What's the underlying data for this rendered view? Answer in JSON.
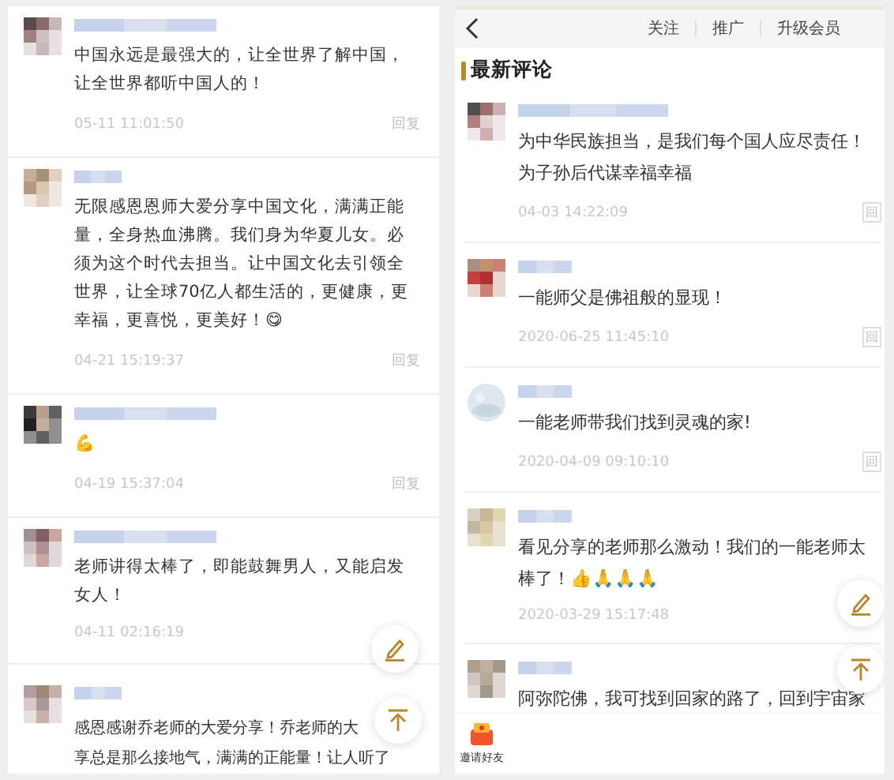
{
  "left_panel": {
    "comments": [
      {
        "text": "中国永远是最强大的，让全世界了解中国，让全世界都听中国人的！",
        "time": "05-11 11:01:50",
        "reply": "回复"
      },
      {
        "text": "无限感恩恩师大爱分享中国文化，满满正能量，全身热血沸腾。我们身为华夏儿女。必须为这个时代去担当。让中国文化去引领全世界，让全球70亿人都生活的，更健康，更幸福，更喜悦，更美好！😋",
        "time": "04-21 15:19:37",
        "reply": "回复"
      },
      {
        "text": "💪",
        "time": "04-19 15:37:04",
        "reply": "回复"
      },
      {
        "text": "老师讲得太棒了，即能鼓舞男人，又能启发女人！",
        "time": "04-11 02:16:19"
      },
      {
        "text_lines": [
          "感恩感谢乔老师的大爱分享！乔老师的大",
          "享总是那么接地气，满满的正能量！让人听了"
        ]
      }
    ]
  },
  "right_panel": {
    "header_tabs": [
      "关注",
      "推广",
      "升级会员"
    ],
    "section_title": "最新评论",
    "comments": [
      {
        "text": "为中华民族担当，是我们每个国人应尽责任！为子孙后代谋幸福幸福",
        "time": "04-03 14:22:09",
        "reply": "回"
      },
      {
        "text": "一能师父是佛祖般的显现！",
        "time": "2020-06-25 11:45:10",
        "reply": "回"
      },
      {
        "text": "一能老师带我们找到灵魂的家!",
        "time": "2020-04-09 09:10:10",
        "reply": "回"
      },
      {
        "text": "看见分享的老师那么激动！我们的一能老师太棒了！👍🙏🙏🙏",
        "time": "2020-03-29 15:17:48"
      },
      {
        "text": "阿弥陀佛，我可找到回家的路了，回到宇宙家"
      }
    ],
    "bottom_bar": {
      "invite_label": "邀请好友"
    }
  }
}
